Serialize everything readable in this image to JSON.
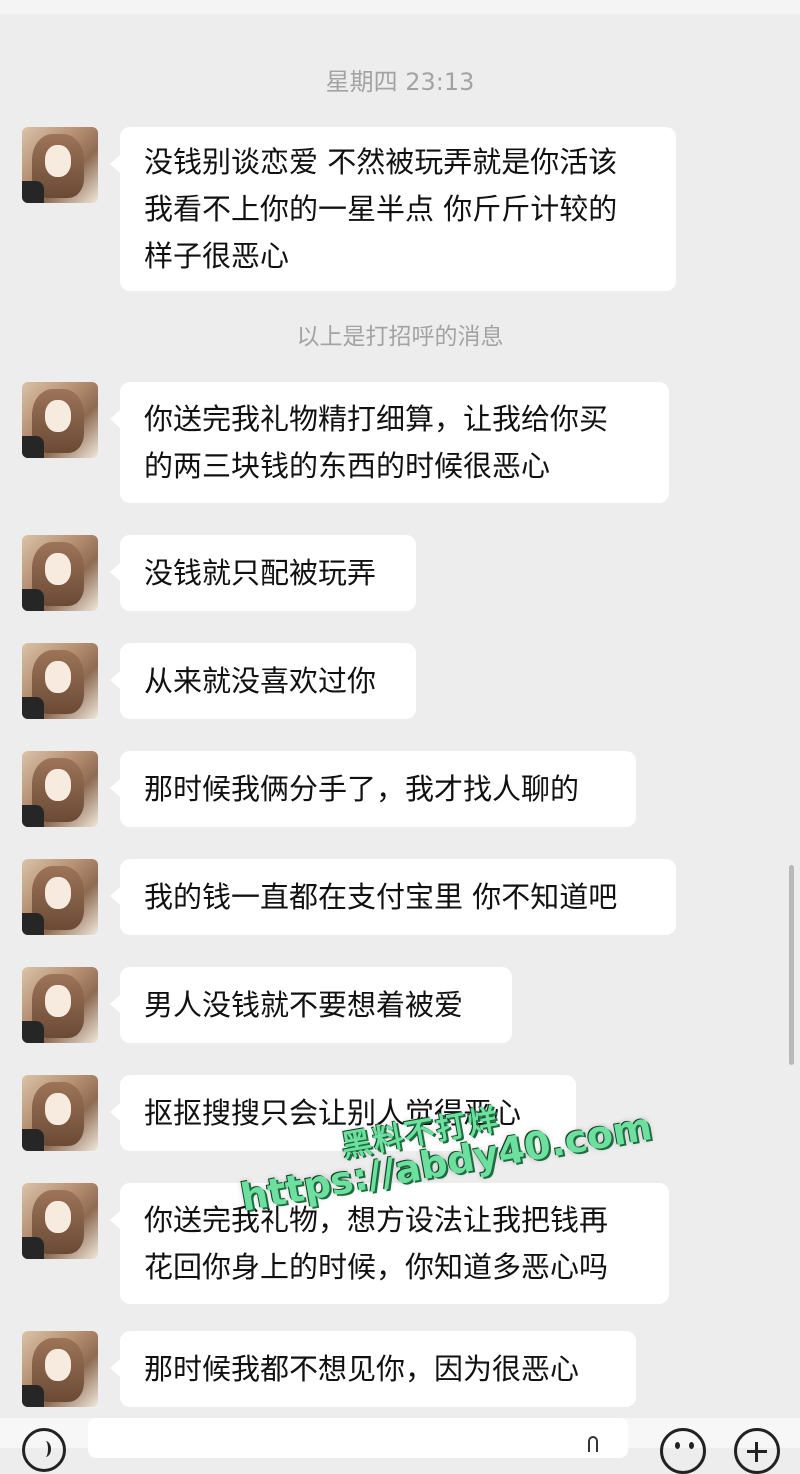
{
  "chat": {
    "timestamp": "星期四 23:13",
    "system_notice": "以上是打招呼的消息",
    "messages": [
      {
        "lines": [
          "没钱别谈恋爱 不然被玩弄就是你活该",
          "我看不上你的一星半点 你斤斤计较的",
          "样子很恶心"
        ]
      },
      {
        "lines": [
          "你送完我礼物精打细算，让我给你买",
          "的两三块钱的东西的时候很恶心"
        ]
      },
      {
        "lines": [
          "没钱就只配被玩弄"
        ]
      },
      {
        "lines": [
          "从来就没喜欢过你"
        ]
      },
      {
        "lines": [
          "那时候我俩分手了，我才找人聊的"
        ]
      },
      {
        "lines": [
          "我的钱一直都在支付宝里 你不知道吧"
        ]
      },
      {
        "lines": [
          "男人没钱就不要想着被爱"
        ]
      },
      {
        "lines": [
          "抠抠搜搜只会让别人觉得恶心"
        ]
      },
      {
        "lines": [
          "你送完我礼物，想方设法让我把钱再",
          "花回你身上的时候，你知道多恶心吗"
        ]
      },
      {
        "lines": [
          "那时候我都不想见你，因为很恶心"
        ]
      }
    ]
  },
  "watermark": {
    "line1": "黑料不打烊",
    "line2": "https://abdy40.com"
  },
  "icons": {
    "voice": "voice-icon",
    "emoji": "emoji-icon",
    "plus": "plus-icon",
    "avatar": "avatar"
  }
}
